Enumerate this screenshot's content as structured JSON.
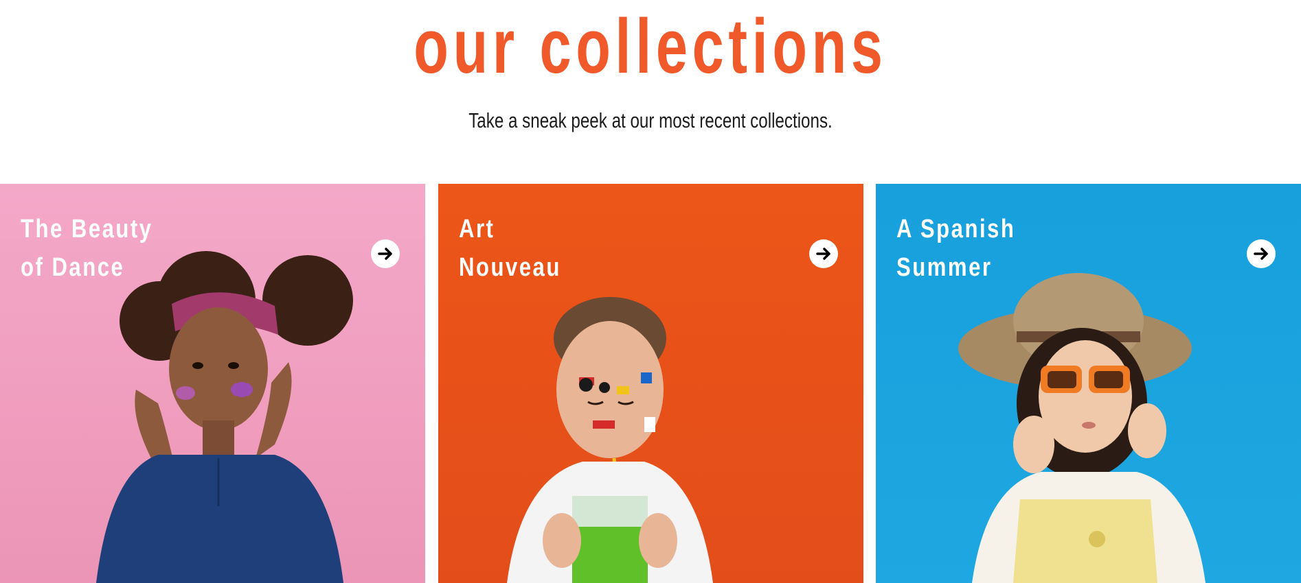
{
  "section": {
    "title": "our collections",
    "subtitle": "Take a sneak peek at our most recent collections."
  },
  "collections": [
    {
      "title_line1": "The Beauty",
      "title_line2": "of Dance",
      "bg": "#f2a3c3",
      "icon": "arrow-right-icon"
    },
    {
      "title_line1": "Art",
      "title_line2": "Nouveau",
      "bg": "#e8501c",
      "icon": "arrow-right-icon"
    },
    {
      "title_line1": "A Spanish",
      "title_line2": "Summer",
      "bg": "#1aa1da",
      "icon": "arrow-right-icon"
    }
  ],
  "colors": {
    "accent": "#f05a2a",
    "text": "#1c1c1c"
  }
}
